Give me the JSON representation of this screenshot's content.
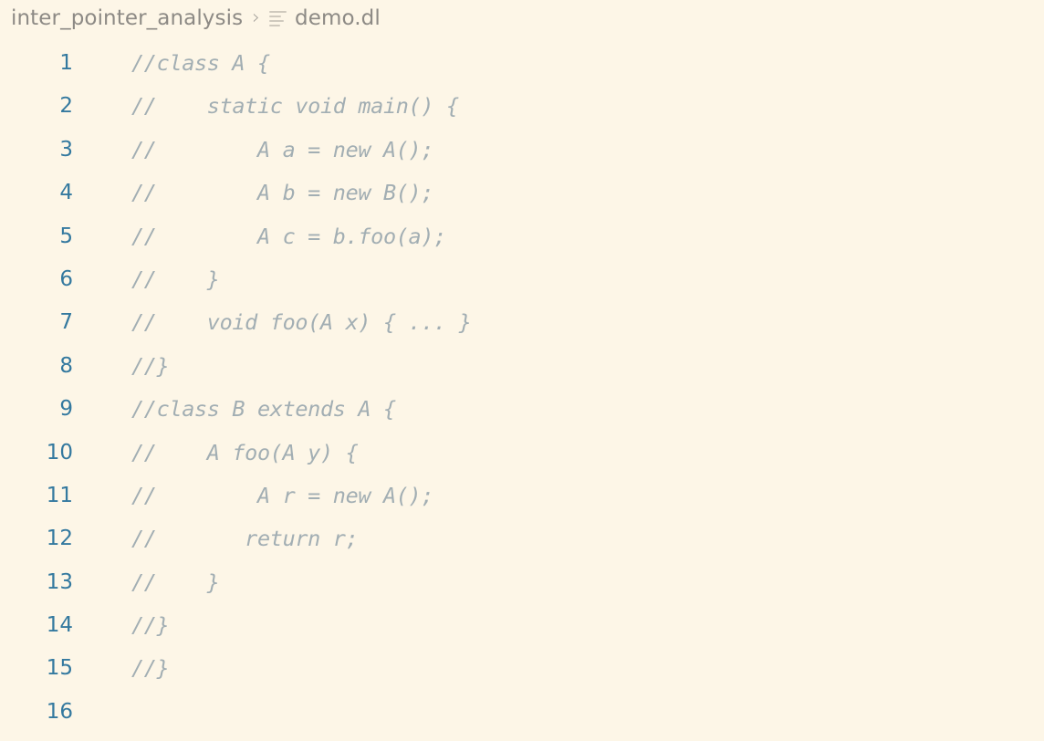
{
  "breadcrumb": {
    "project": "inter_pointer_analysis",
    "separator": "›",
    "file_icon": "file-lines-icon",
    "file": "demo.dl"
  },
  "colors": {
    "background": "#fdf6e7",
    "line_number": "#34799f",
    "comment_text": "#a2aeb3",
    "breadcrumb_text": "#8d8a85",
    "icon": "#cfc9bd"
  },
  "editor": {
    "language": "datalog",
    "lines": [
      {
        "number": "1",
        "text": "//class A {"
      },
      {
        "number": "2",
        "text": "//    static void main() {"
      },
      {
        "number": "3",
        "text": "//        A a = new A();"
      },
      {
        "number": "4",
        "text": "//        A b = new B();"
      },
      {
        "number": "5",
        "text": "//        A c = b.foo(a);"
      },
      {
        "number": "6",
        "text": "//    }"
      },
      {
        "number": "7",
        "text": "//    void foo(A x) { ... }"
      },
      {
        "number": "8",
        "text": "//}"
      },
      {
        "number": "9",
        "text": "//class B extends A {"
      },
      {
        "number": "10",
        "text": "//    A foo(A y) {"
      },
      {
        "number": "11",
        "text": "//        A r = new A();"
      },
      {
        "number": "12",
        "text": "//       return r;"
      },
      {
        "number": "13",
        "text": "//    }"
      },
      {
        "number": "14",
        "text": "//}"
      },
      {
        "number": "15",
        "text": "//}"
      },
      {
        "number": "16",
        "text": ""
      }
    ]
  }
}
